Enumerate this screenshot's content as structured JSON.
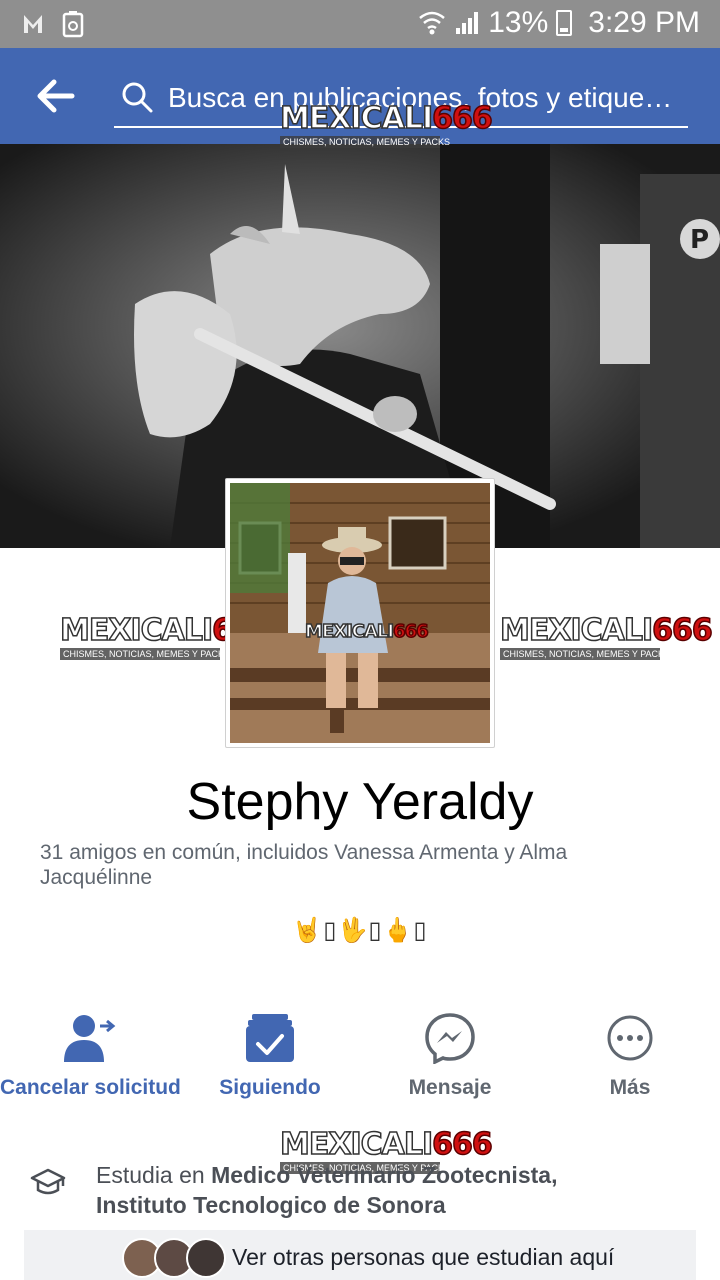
{
  "status_bar": {
    "battery": "13%",
    "time": "3:29 PM",
    "icons": [
      "mail-icon",
      "recycle-icon",
      "wifi-icon",
      "signal-icon",
      "battery-icon"
    ]
  },
  "header": {
    "search_placeholder": "Busca en publicaciones, fotos y etique…",
    "bg_color": "#4267b2"
  },
  "watermark": {
    "brand_white": "MEXICALI",
    "brand_red": "666",
    "tagline": "CHISMES, NOTICIAS, MEMES Y PACKS"
  },
  "profile": {
    "name": "Stephy Yeraldy",
    "mutual_friends": "31 amigos en común, incluidos Vanessa Armenta y Alma Jacquélinne",
    "bio": "🤘▯🖖▯🖕▯"
  },
  "actions": [
    {
      "label": "Cancelar solicitud",
      "icon": "cancel-request-icon",
      "color": "#4267b2"
    },
    {
      "label": "Siguiendo",
      "icon": "following-icon",
      "color": "#4267b2"
    },
    {
      "label": "Mensaje",
      "icon": "messenger-icon",
      "color": "#606770"
    },
    {
      "label": "Más",
      "icon": "more-icon",
      "color": "#606770"
    }
  ],
  "education": {
    "prefix": "Estudia en ",
    "line1_bold": "Medico Veterinario Zootecnista,",
    "line2_bold": "Instituto Tecnologico de Sonora",
    "see_others": "Ver otras personas que estudian aquí"
  }
}
